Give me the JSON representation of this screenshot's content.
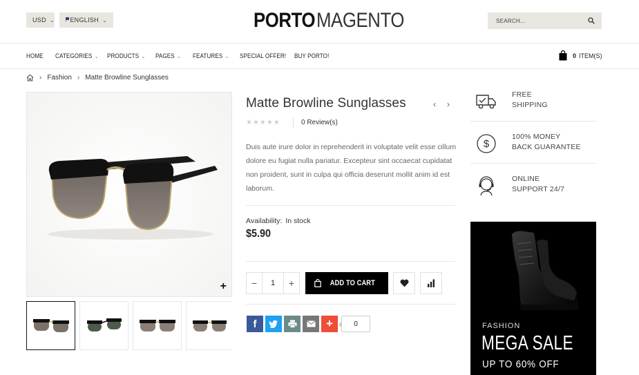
{
  "header": {
    "currency": "USD",
    "language": "ENGLISH",
    "logo_bold": "PORTO",
    "logo_light": "MAGENTO",
    "search_placeholder": "SEARCH..."
  },
  "nav": {
    "items": [
      {
        "label": "HOME"
      },
      {
        "label": "CATEGORIES"
      },
      {
        "label": "PRODUCTS"
      },
      {
        "label": "PAGES"
      },
      {
        "label": "FEATURES"
      },
      {
        "label": "SPECIAL OFFER!"
      },
      {
        "label": "BUY PORTO!"
      }
    ],
    "cart_count": "0",
    "cart_label": "ITEM(S)"
  },
  "breadcrumb": {
    "category": "Fashion",
    "current": "Matte Browline Sunglasses"
  },
  "product": {
    "title": "Matte Browline Sunglasses",
    "stars": "★★★★★",
    "rating": 0,
    "reviews": "0 Review(s)",
    "description": "Duis aute irure dolor in reprehenderit in voluptate velit esse cillum dolore eu fugiat nulla pariatur. Excepteur sint occaecat cupidatat non proident, sunt in culpa qui officia deserunt mollit anim id est laborum.",
    "availability_label": "Availability:",
    "availability_value": "In stock",
    "price": "$5.90",
    "quantity": "1",
    "add_to_cart": "ADD TO CART",
    "share_count": "0"
  },
  "features": [
    {
      "line1": "FREE",
      "line2": "SHIPPING"
    },
    {
      "line1": "100% MONEY",
      "line2": "BACK GUARANTEE"
    },
    {
      "line1": "ONLINE",
      "line2": "SUPPORT 24/7"
    }
  ],
  "banner": {
    "subtitle": "FASHION",
    "title": "MEGA SALE",
    "offer": "UP TO 60% OFF"
  },
  "colors": {
    "facebook": "#3b5998",
    "twitter": "#1da1f2",
    "print": "#6d8a8a",
    "email": "#777777",
    "more": "#f04e37"
  }
}
